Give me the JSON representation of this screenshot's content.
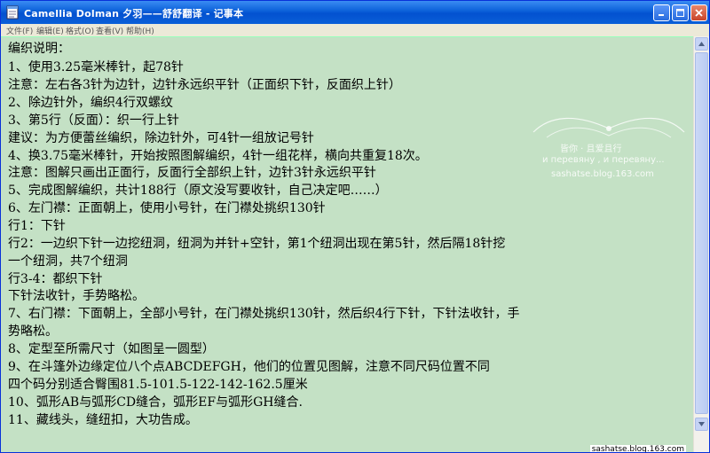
{
  "window": {
    "title": "Camellia Dolman 夕羽——舒舒翻译 - 记事本"
  },
  "menu": [
    "文件(F)",
    "编辑(E)",
    "格式(O)",
    "查看(V)",
    "帮助(H)"
  ],
  "text_lines": [
    "编织说明：",
    "1、使用3.25毫米棒针，起78针",
    "    注意：左右各3针为边针，边针永远织平针（正面织下针，反面织上针）",
    "2、除边针外，编织4行双螺纹",
    "3、第5行（反面）：织一行上针",
    "    建议：为方便蕾丝编织，除边针外，可4针一组放记号针",
    "4、换3.75毫米棒针，开始按照图解编织，4针一组花样，横向共重复18次。",
    "    注意：图解只画出正面行，反面行全部织上针，边针3针永远织平针",
    "5、完成图解编织，共计188行（原文没写要收针，自己决定吧……）",
    "6、左门襟：正面朝上，使用小号针，在门襟处挑织130针",
    "    行1：下针",
    "    行2：一边织下针一边挖纽洞，纽洞为并针+空针，第1个纽洞出现在第5针，然后隔18针挖",
    "    一个纽洞，共7个纽洞",
    "    行3-4：都织下针",
    "    下针法收针，手势略松。",
    "7、右门襟：下面朝上，全部小号针，在门襟处挑织130针，然后织4行下针，下针法收针，手",
    "    势略松。",
    "8、定型至所需尺寸（如图呈一圆型）",
    "9、在斗篷外边缘定位八个点ABCDEFGH，他们的位置见图解，注意不同尺码位置不同",
    "    四个码分别适合臀围81.5-101.5-122-142-162.5厘米",
    "10、弧形AB与弧形CD缝合，弧形EF与弧形GH缝合.",
    "11、藏线头，缝纽扣，大功告成。"
  ],
  "watermark": {
    "line1": "皆你 · 且爱且行",
    "line2": "и перевяну , и перевяну...",
    "line3": "sashatse.blog.163.com"
  },
  "footer_url": "sashatse.blog.163.com"
}
